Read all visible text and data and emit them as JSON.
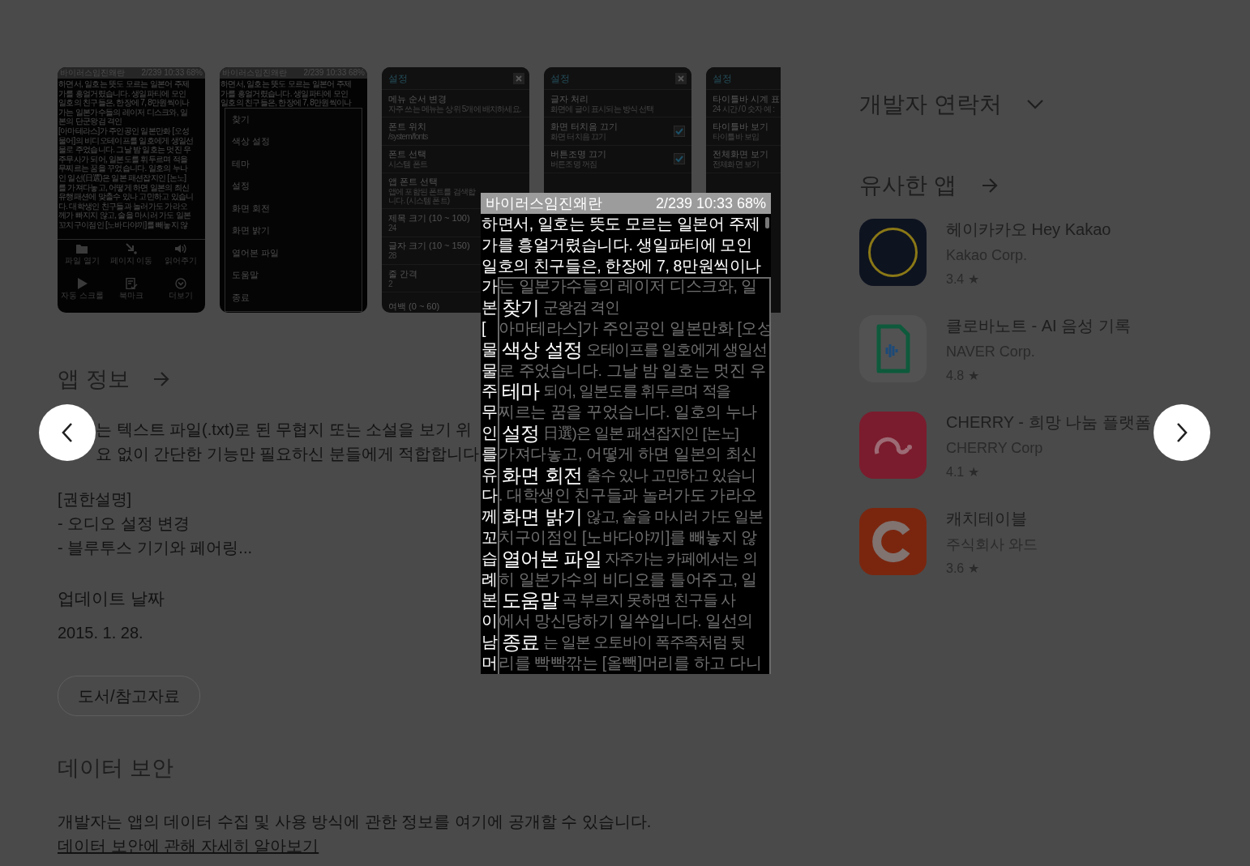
{
  "screenshots": [
    {
      "kind": "reader",
      "title": "바이러스임진왜란",
      "status": "2/239 10:33 68%",
      "lines": [
        "하면서, 일호는 뜻도 모르는 일본어 주제",
        "가를 흥얼거렸습니다. 생일파티에 모인",
        "일호의 친구들은, 한장에 7, 8만원씩이나",
        "가는 일본가수들의 레이저 디스크와, 일",
        "본의 단군왕검 격인",
        "[아마테라스]가 주인공인 일본만화 [오성",
        "물어]의 비디오테이프를 일호에게 생일선",
        "물로 주었습니다. 그날 밤 일호는 멋진 우",
        "주무사가 되어, 일본도를 휘두르며 적을",
        "무찌르는 꿈을 꾸었습니다. 일호의 누나",
        "인 일선(日選)은 일본 패션잡지인 [논노]",
        "를 가져다놓고, 어떻게 하면 일본의 최신",
        "유행패션에 맞출수 있나 고민하고 있습니",
        "다. 대학생인 친구들과 놀러가도 가라오",
        "께가 빠지지 않고, 술을 마시러 가도 일본",
        "꼬치구이점인 [노바다야끼]를 빼놓지 않"
      ],
      "toolbar": [
        "파일 열기",
        "페이지 이동",
        "읽어주기",
        "자동 스크롤",
        "북마크",
        "더보기"
      ]
    },
    {
      "kind": "menu",
      "title": "바이러스임진왜란",
      "status": "2/239 10:33 68%",
      "lines": [
        "하면서, 일호는 뜻도 모르는 일본어 주제",
        "가를 흥얼거렸습니다. 생일파티에 모인",
        "일호의 친구들은, 한장에 7, 8만원씩이나"
      ],
      "menu": [
        "찾기",
        "색상 설정",
        "테마",
        "설정",
        "화면 회전",
        "화면 밝기",
        "열어본 파일",
        "도움말",
        "종료"
      ]
    },
    {
      "kind": "settings",
      "title": "설정",
      "close": true,
      "items": [
        {
          "title": "메뉴 순서 변경",
          "subtitle": "자주 쓰는 메뉴는 상위 5개에 배치하세요."
        },
        {
          "title": "폰트 위치",
          "subtitle": "/system/fonts"
        },
        {
          "title": "폰트 선택",
          "subtitle": "시스템 폰트"
        },
        {
          "title": "앱 폰트 선택",
          "subtitle": "앱에 포함된 폰트를 검색합니다. (시스템 폰트)"
        },
        {
          "title": "제목 크기 (10 ~ 100)",
          "subtitle": "24"
        },
        {
          "title": "글자 크기 (10 ~ 150)",
          "subtitle": "28"
        },
        {
          "title": "줄 간격",
          "subtitle": "2"
        },
        {
          "title": "여백 (0 ~ 60)"
        }
      ]
    },
    {
      "kind": "settings",
      "title": "설정",
      "close": true,
      "items": [
        {
          "title": "글자 처리",
          "subtitle": "화면에 글이 표시되는 방식 선택"
        },
        {
          "title": "화면 터치음 끄기",
          "subtitle": "화면 터치음 끄기",
          "checked": true
        },
        {
          "title": "버튼조명 끄기",
          "subtitle": "버튼조명 꺼짐",
          "checked": true
        }
      ]
    },
    {
      "kind": "settings",
      "title": "설정",
      "close": false,
      "items": [
        {
          "title": "타이틀바 시계 표",
          "subtitle": "24 시간 / 0 숫자 예 :"
        },
        {
          "title": "타이틀바 보기",
          "subtitle": "타이틀바 보임"
        },
        {
          "title": "전체화면 보기",
          "subtitle": "전체화면 보기"
        }
      ]
    }
  ],
  "app_info": {
    "heading": "앱 정보",
    "description": [
      "는 텍스트 파일(.txt)로 된 무협지 또는 소설을 보기 위",
      "요 없이 간단한 기능만 필요하신 분들에게 적합합니다"
    ],
    "permissions": [
      "[권한설명]",
      "- 오디오 설정 변경",
      "- 블루투스 기기와 페어링..."
    ],
    "updated_label": "업데이트 날짜",
    "updated": "2015. 1. 28.",
    "category": "도서/참고자료"
  },
  "data_safety": {
    "heading": "데이터 보안",
    "text": "개발자는 앱의 데이터 수집 및 사용 방식에 관한 정보를 여기에 공개할 수 있습니다.",
    "link": "데이터 보안에 관해 자세히 알아보기"
  },
  "developer_contact": {
    "heading": "개발자 연락처",
    "expanded": false
  },
  "similar_apps": {
    "heading": "유사한 앱",
    "apps": [
      {
        "name": "헤이카카오 Hey Kakao",
        "developer": "Kakao Corp.",
        "rating": "3.4 ★"
      },
      {
        "name": "클로바노트 - AI 음성 기록",
        "developer": "NAVER Corp.",
        "rating": "4.8 ★"
      },
      {
        "name": "CHERRY - 희망 나눔 플랫폼",
        "developer": "CHERRY Corp",
        "rating": "4.1 ★"
      },
      {
        "name": "캐치테이블",
        "developer": "주식회사 와드",
        "rating": "3.6 ★"
      }
    ]
  },
  "viewer": {
    "title": "바이러스임진왜란",
    "status": "2/239 10:33 68%",
    "lines": [
      "하면서, 일호는 뜻도 모르는 일본어 주제",
      "가를 흥얼거렸습니다. 생일파티에 모인",
      "일호의 친구들은, 한장에 7, 8만원씩이나"
    ],
    "rows": [
      {
        "lead": "가",
        "rest": "는 일본가수들의 레이저 디스크와, 일"
      },
      {
        "lead": "본",
        "menu": "찾기",
        "rest": "군왕검 격인"
      },
      {
        "lead": "[",
        "rest": "아마테라스]가 주인공인 일본만화 [오성"
      },
      {
        "lead": "물",
        "menu": "색상 설정",
        "rest": "오테이프를 일호에게 생일선"
      },
      {
        "lead": "물",
        "rest": "로 주었습니다. 그날 밤 일호는 멋진 우"
      },
      {
        "lead": "주",
        "menu": "테마",
        "rest": "되어, 일본도를 휘두르며 적을"
      },
      {
        "lead": "무",
        "rest": "찌르는 꿈을 꾸었습니다. 일호의 누나"
      },
      {
        "lead": "인",
        "menu": "설정",
        "rest": "日選)은 일본 패션잡지인 [논노]"
      },
      {
        "lead": "를",
        "rest": "가져다놓고, 어떻게 하면 일본의 최신"
      },
      {
        "lead": "유",
        "menu": "화면 회전",
        "rest": "출수 있나 고민하고 있습니"
      },
      {
        "lead": "다",
        "rest": ". 대학생인 친구들과 놀러가도 가라오"
      },
      {
        "lead": "께",
        "menu": "화면 밝기",
        "rest": "않고, 술을 마시러 가도 일본"
      },
      {
        "lead": "꼬",
        "rest": "치구이점인 [노바다야끼]를 빼놓지 않"
      },
      {
        "lead": "습",
        "menu": "열어본 파일",
        "rest": "자주가는 카페에서는 의"
      },
      {
        "lead": "례",
        "rest": "히 일본가수의 비디오를 틀어주고, 일"
      },
      {
        "lead": "본",
        "menu": "도움말",
        "rest": "곡 부르지 못하면 친구들 사"
      },
      {
        "lead": "이",
        "rest": "에서 망신당하기 일쑤입니다. 일선의"
      },
      {
        "lead": "남",
        "menu": "종료",
        "rest": "는 일본 오토바이 폭주족처럼 뒷"
      },
      {
        "lead": "머",
        "rest": "리를 빡빡깎는 [올빽]머리를 하고 다니"
      }
    ]
  }
}
